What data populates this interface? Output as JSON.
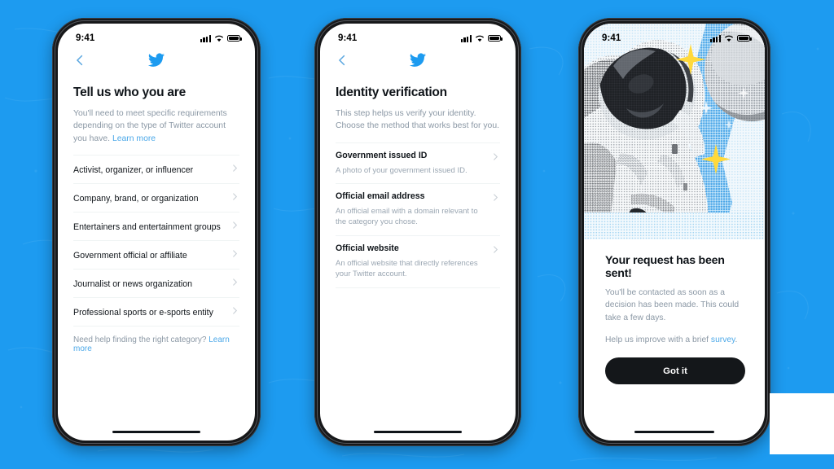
{
  "theme": {
    "brand_blue": "#1D9BF0",
    "text_dark": "#0F1419",
    "text_muted": "#8B98A5",
    "link_blue": "#4BA8E8",
    "button_black": "#14171A",
    "divider": "#EFF3F4"
  },
  "status_bar": {
    "time": "9:41",
    "signal_icon": "cellular-bars-icon",
    "wifi_icon": "wifi-icon",
    "battery_icon": "battery-full-icon"
  },
  "screens": [
    {
      "id": "tell-us-who-you-are",
      "back_icon": "chevron-left-icon",
      "logo_icon": "twitter-bird-icon",
      "title": "Tell us who you are",
      "subtitle_text": "You'll need to meet specific requirements depending on the type of Twitter account you have. ",
      "subtitle_link": "Learn more",
      "options": [
        {
          "label": "Activist, organizer, or influencer",
          "chevron_icon": "chevron-right-icon"
        },
        {
          "label": "Company, brand, or organization",
          "chevron_icon": "chevron-right-icon"
        },
        {
          "label": "Entertainers and entertainment groups",
          "chevron_icon": "chevron-right-icon"
        },
        {
          "label": "Government official or affiliate",
          "chevron_icon": "chevron-right-icon"
        },
        {
          "label": "Journalist or news organization",
          "chevron_icon": "chevron-right-icon"
        },
        {
          "label": "Professional sports or e-sports entity",
          "chevron_icon": "chevron-right-icon"
        }
      ],
      "footnote_text": "Need help finding the right category? ",
      "footnote_link": "Learn more"
    },
    {
      "id": "identity-verification",
      "back_icon": "chevron-left-icon",
      "logo_icon": "twitter-bird-icon",
      "title": "Identity verification",
      "subtitle_text": "This step helps us verify your identity. Choose the method that works best for you.",
      "methods": [
        {
          "label": "Government issued ID",
          "description": "A photo of your government issued ID.",
          "chevron_icon": "chevron-right-icon"
        },
        {
          "label": "Official email address",
          "description": "An official email with a domain relevant to the category you chose.",
          "chevron_icon": "chevron-right-icon"
        },
        {
          "label": "Official website",
          "description": "An official website that directly references your Twitter account.",
          "chevron_icon": "chevron-right-icon"
        }
      ]
    },
    {
      "id": "request-sent",
      "hero_image_name": "astronaut-halftone-collage",
      "title": "Your request has been sent!",
      "subtitle": "You'll be contacted as soon as a decision has been made. This could take a few days.",
      "survey_text": "Help us improve with a brief ",
      "survey_link": "survey",
      "survey_suffix": ".",
      "cta_label": "Got it"
    }
  ]
}
